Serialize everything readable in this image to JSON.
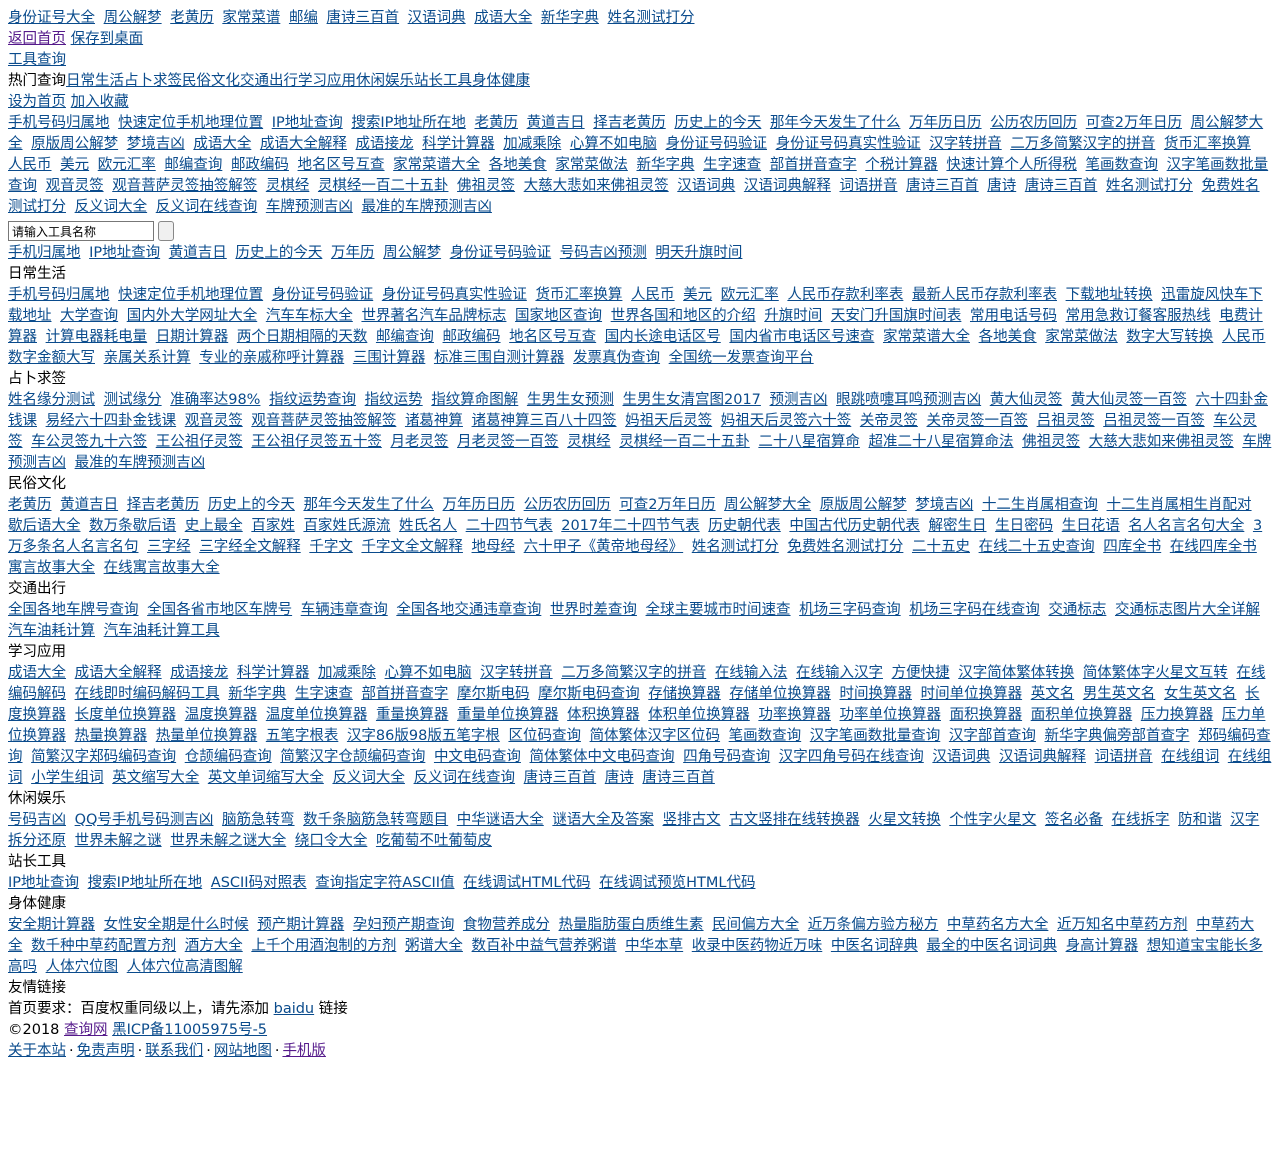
{
  "top_nav": [
    "身份证号大全",
    "周公解梦",
    "老黄历",
    "家常菜谱",
    "邮编",
    "唐诗三百首",
    "汉语词典",
    "成语大全",
    "新华字典",
    "姓名测试打分"
  ],
  "actions": {
    "back_home": "返回首页",
    "save_desktop": "保存到桌面"
  },
  "tool_query": "工具查询",
  "hot": {
    "label": "热门查询",
    "categories": [
      "日常生活",
      "占卜求签",
      "民俗文化",
      "交通出行",
      "学习应用",
      "休闲娱乐",
      "站长工具",
      "身体健康"
    ]
  },
  "home_actions": {
    "set_home": "设为首页",
    "add_fav": "加入收藏"
  },
  "popular_links": [
    "手机号码归属地",
    "快速定位手机地理位置",
    "IP地址查询",
    "搜索IP地址所在地",
    "老黄历",
    "黄道吉日",
    "择吉老黄历",
    "历史上的今天",
    "那年今天发生了什么",
    "万年历日历",
    "公历农历回历",
    "可查2万年日历",
    "周公解梦大全",
    "原版周公解梦",
    "梦境吉凶",
    "成语大全",
    "成语大全解释",
    "成语接龙",
    "科学计算器",
    "加减乘除",
    "心算不如电脑",
    "身份证号码验证",
    "身份证号码真实性验证",
    "汉字转拼音",
    "二万多简繁汉字的拼音",
    "货币汇率换算",
    "人民币",
    "美元",
    "欧元汇率",
    "邮编查询",
    "邮政编码",
    "地名区号互查",
    "家常菜谱大全",
    "各地美食",
    "家常菜做法",
    "新华字典",
    "生字速查",
    "部首拼音查字",
    "个税计算器",
    "快速计算个人所得税",
    "笔画数查询",
    "汉字笔画数批量查询",
    "观音灵签",
    "观音菩萨灵签抽签解签",
    "灵棋经",
    "灵棋经一百二十五卦",
    "佛祖灵签",
    "大慈大悲如来佛祖灵签",
    "汉语词典",
    "汉语词典解释",
    "词语拼音",
    "唐诗三百首",
    "唐诗",
    "唐诗三百首",
    "姓名测试打分",
    "免费姓名测试打分",
    "反义词大全",
    "反义词在线查询",
    "车牌预测吉凶",
    "最准的车牌预测吉凶"
  ],
  "search": {
    "placeholder": "请输入工具名称",
    "value": "请输入工具名称"
  },
  "quick_links": [
    "手机归属地",
    "IP地址查询",
    "黄道吉日",
    "历史上的今天",
    "万年历",
    "周公解梦",
    "身份证号码验证",
    "号码吉凶预测",
    "明天升旗时间"
  ],
  "sections": [
    {
      "title": "日常生活",
      "links": [
        "手机号码归属地",
        "快速定位手机地理位置",
        "身份证号码验证",
        "身份证号码真实性验证",
        "货币汇率换算",
        "人民币",
        "美元",
        "欧元汇率",
        "人民币存款利率表",
        "最新人民币存款利率表",
        "下载地址转换",
        "迅雷旋风快车下载地址",
        "大学查询",
        "国内外大学网址大全",
        "汽车车标大全",
        "世界著名汽车品牌标志",
        "国家地区查询",
        "世界各国和地区的介绍",
        "升旗时间",
        "天安门升国旗时间表",
        "常用电话号码",
        "常用急救订餐客服热线",
        "电费计算器",
        "计算电器耗电量",
        "日期计算器",
        "两个日期相隔的天数",
        "邮编查询",
        "邮政编码",
        "地名区号互查",
        "国内长途电话区号",
        "国内省市电话区号速查",
        "家常菜谱大全",
        "各地美食",
        "家常菜做法",
        "数字大写转换",
        "人民币数字金额大写",
        "亲属关系计算",
        "专业的亲戚称呼计算器",
        "三围计算器",
        "标准三围自测计算器",
        "发票真伪查询",
        "全国统一发票查询平台"
      ]
    },
    {
      "title": "占卜求签",
      "links": [
        "姓名缘分测试",
        "测试缘分",
        "准确率达98%",
        "指纹运势查询",
        "指纹运势",
        "指纹算命图解",
        "生男生女预测",
        "生男生女清宫图2017",
        "预测吉凶",
        "眼跳喷嚏耳鸣预测吉凶",
        "黄大仙灵签",
        "黄大仙灵签一百签",
        "六十四卦金钱课",
        "易经六十四卦金钱课",
        "观音灵签",
        "观音菩萨灵签抽签解签",
        "诸葛神算",
        "诸葛神算三百八十四签",
        "妈祖天后灵签",
        "妈祖天后灵签六十签",
        "关帝灵签",
        "关帝灵签一百签",
        "吕祖灵签",
        "吕祖灵签一百签",
        "车公灵签",
        "车公灵签九十六签",
        "王公祖仔灵签",
        "王公祖仔灵签五十签",
        "月老灵签",
        "月老灵签一百签",
        "灵棋经",
        "灵棋经一百二十五卦",
        "二十八星宿算命",
        "超准二十八星宿算命法",
        "佛祖灵签",
        "大慈大悲如来佛祖灵签",
        "车牌预测吉凶",
        "最准的车牌预测吉凶"
      ]
    },
    {
      "title": "民俗文化",
      "links": [
        "老黄历",
        "黄道吉日",
        "择吉老黄历",
        "历史上的今天",
        "那年今天发生了什么",
        "万年历日历",
        "公历农历回历",
        "可查2万年日历",
        "周公解梦大全",
        "原版周公解梦",
        "梦境吉凶",
        "十二生肖属相查询",
        "十二生肖属相生肖配对",
        "歇后语大全",
        "数万条歇后语",
        "史上最全",
        "百家姓",
        "百家姓氏源流",
        "姓氏名人",
        "二十四节气表",
        "2017年二十四节气表",
        "历史朝代表",
        "中国古代历史朝代表",
        "解密生日",
        "生日密码",
        "生日花语",
        "名人名言名句大全",
        "3万多条名人名言名句",
        "三字经",
        "三字经全文解释",
        "千字文",
        "千字文全文解释",
        "地母经",
        "六十甲子《黄帝地母经》",
        "姓名测试打分",
        "免费姓名测试打分",
        "二十五史",
        "在线二十五史查询",
        "四库全书",
        "在线四库全书",
        "寓言故事大全",
        "在线寓言故事大全"
      ]
    },
    {
      "title": "交通出行",
      "links": [
        "全国各地车牌号查询",
        "全国各省市地区车牌号",
        "车辆违章查询",
        "全国各地交通违章查询",
        "世界时差查询",
        "全球主要城市时间速查",
        "机场三字码查询",
        "机场三字码在线查询",
        "交通标志",
        "交通标志图片大全详解",
        "汽车油耗计算",
        "汽车油耗计算工具"
      ]
    },
    {
      "title": "学习应用",
      "links": [
        "成语大全",
        "成语大全解释",
        "成语接龙",
        "科学计算器",
        "加减乘除",
        "心算不如电脑",
        "汉字转拼音",
        "二万多简繁汉字的拼音",
        "在线输入法",
        "在线输入汉字",
        "方便快捷",
        "汉字简体繁体转换",
        "简体繁体字火星文互转",
        "在线编码解码",
        "在线即时编码解码工具",
        "新华字典",
        "生字速查",
        "部首拼音查字",
        "摩尔斯电码",
        "摩尔斯电码查询",
        "存储换算器",
        "存储单位换算器",
        "时间换算器",
        "时间单位换算器",
        "英文名",
        "男生英文名",
        "女生英文名",
        "长度换算器",
        "长度单位换算器",
        "温度换算器",
        "温度单位换算器",
        "重量换算器",
        "重量单位换算器",
        "体积换算器",
        "体积单位换算器",
        "功率换算器",
        "功率单位换算器",
        "面积换算器",
        "面积单位换算器",
        "压力换算器",
        "压力单位换算器",
        "热量换算器",
        "热量单位换算器",
        "五笔字根表",
        "汉字86版98版五笔字根",
        "区位码查询",
        "简体繁体汉字区位码",
        "笔画数查询",
        "汉字笔画数批量查询",
        "汉字部首查询",
        "新华字典偏旁部首查字",
        "郑码编码查询",
        "简繁汉字郑码编码查询",
        "仓颉编码查询",
        "简繁汉字仓颉编码查询",
        "中文电码查询",
        "简体繁体中文电码查询",
        "四角号码查询",
        "汉字四角号码在线查询",
        "汉语词典",
        "汉语词典解释",
        "词语拼音",
        "在线组词",
        "在线组词",
        "小学生组词",
        "英文缩写大全",
        "英文单词缩写大全",
        "反义词大全",
        "反义词在线查询",
        "唐诗三百首",
        "唐诗",
        "唐诗三百首"
      ]
    },
    {
      "title": "休闲娱乐",
      "links": [
        "号码吉凶",
        "QQ号手机号码测吉凶",
        "脑筋急转弯",
        "数千条脑筋急转弯题目",
        "中华谜语大全",
        "谜语大全及答案",
        "竖排古文",
        "古文竖排在线转换器",
        "火星文转换",
        "个性字火星文",
        "签名必备",
        "在线拆字",
        "防和谐",
        "汉字拆分还原",
        "世界未解之谜",
        "世界未解之谜大全",
        "绕口令大全",
        "吃葡萄不吐葡萄皮"
      ]
    },
    {
      "title": "站长工具",
      "links": [
        "IP地址查询",
        "搜索IP地址所在地",
        "ASCII码对照表",
        "查询指定字符ASCII值",
        "在线调试HTML代码",
        "在线调试预览HTML代码"
      ]
    },
    {
      "title": "身体健康",
      "links": [
        "安全期计算器",
        "女性安全期是什么时候",
        "预产期计算器",
        "孕妇预产期查询",
        "食物营养成分",
        "热量脂肪蛋白质维生素",
        "民间偏方大全",
        "近万条偏方验方秘方",
        "中草药名方大全",
        "近万知名中草药方剂",
        "中草药大全",
        "数千种中草药配置方剂",
        "酒方大全",
        "上千个用酒泡制的方剂",
        "粥谱大全",
        "数百补中益气营养粥谱",
        "中华本草",
        "收录中医药物近万味",
        "中医名词辞典",
        "最全的中医名词词典",
        "身高计算器",
        "想知道宝宝能长多高吗",
        "人体穴位图",
        "人体穴位高清图解"
      ]
    }
  ],
  "friend_links": {
    "title": "友情链接",
    "requirement_prefix": "首页要求：百度权重同级以上，请先添加",
    "requirement_link": "baidu",
    "requirement_suffix": "链接"
  },
  "copyright": {
    "prefix": "©2018",
    "site": "查询网",
    "icp": "黑ICP备11005975号-5"
  },
  "footer_links": [
    "关于本站",
    "免责声明",
    "联系我们",
    "网站地图",
    "手机版"
  ],
  "colors": {
    "link": "#0a4b8c",
    "visited": "#551a8b",
    "text": "#000000"
  }
}
